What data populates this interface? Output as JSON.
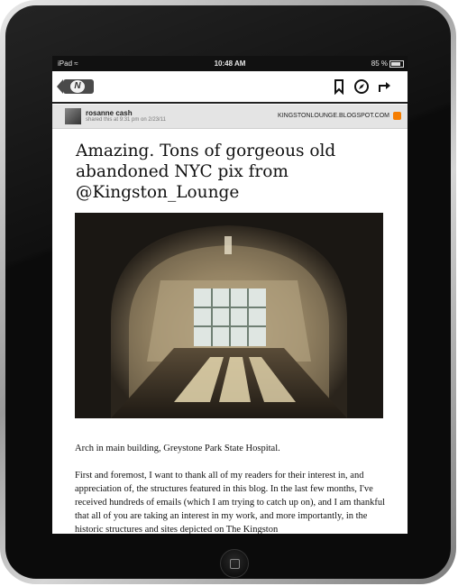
{
  "status_bar": {
    "device": "iPad",
    "time": "10:48 AM",
    "battery": "85 %",
    "battery_level": 0.85
  },
  "toolbar": {
    "back_logo": "N"
  },
  "post": {
    "author": "rosanne cash",
    "shared": "shared this at 9:31 pm on 2/23/11",
    "source": "KINGSTONLOUNGE.BLOGSPOT.COM"
  },
  "article": {
    "title": "Amazing. Tons of gorgeous old abandoned NYC pix from @Kingston_Lounge",
    "caption": "Arch in main building, Greystone Park State Hospital.",
    "body": "First and foremost, I want to thank all of my readers for their interest in, and appreciation of, the structures featured in this blog. In the last few months, I've received hundreds of emails (which I am trying to catch up on), and I am thankful that all of you are taking an interest in my work, and more importantly, in the historic structures and sites depicted on The Kingston"
  },
  "icons": [
    "back-icon",
    "bookmark-icon",
    "compass-icon",
    "share-icon",
    "blogger-icon",
    "wifi-icon",
    "battery-icon",
    "home-button-icon"
  ],
  "colors": {
    "blogger": "#f57d00",
    "header_bg": "#e4e4e4"
  }
}
